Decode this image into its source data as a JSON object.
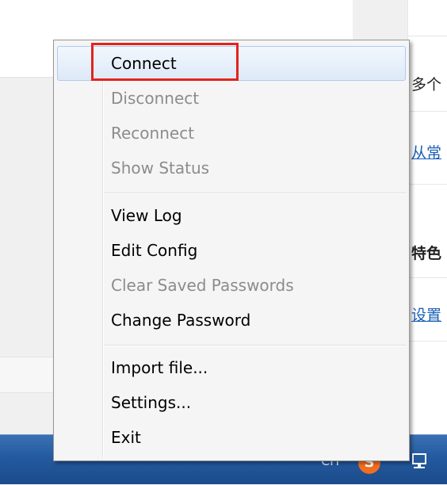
{
  "background": {
    "right_texts": [
      {
        "text": "多个",
        "style": "normal"
      },
      {
        "text": "从常",
        "style": "link"
      },
      {
        "text": "特色",
        "style": "bold"
      },
      {
        "text": "设置",
        "style": "link"
      }
    ]
  },
  "menu": {
    "items": [
      {
        "label": "Connect",
        "enabled": true,
        "hovered": true
      },
      {
        "label": "Disconnect",
        "enabled": false
      },
      {
        "label": "Reconnect",
        "enabled": false
      },
      {
        "label": "Show Status",
        "enabled": false
      },
      {
        "label": "View Log",
        "enabled": true
      },
      {
        "label": "Edit Config",
        "enabled": true
      },
      {
        "label": "Clear Saved Passwords",
        "enabled": false
      },
      {
        "label": "Change Password",
        "enabled": true
      },
      {
        "label": "Import file...",
        "enabled": true
      },
      {
        "label": "Settings...",
        "enabled": true
      },
      {
        "label": "Exit",
        "enabled": true
      }
    ]
  },
  "annotation": {
    "highlight_color": "#e3231c",
    "highlighted_item": "Connect"
  },
  "taskbar": {
    "tray_text": "CH",
    "app_icon_letter": "S",
    "app_icon_color": "#f26d21"
  }
}
